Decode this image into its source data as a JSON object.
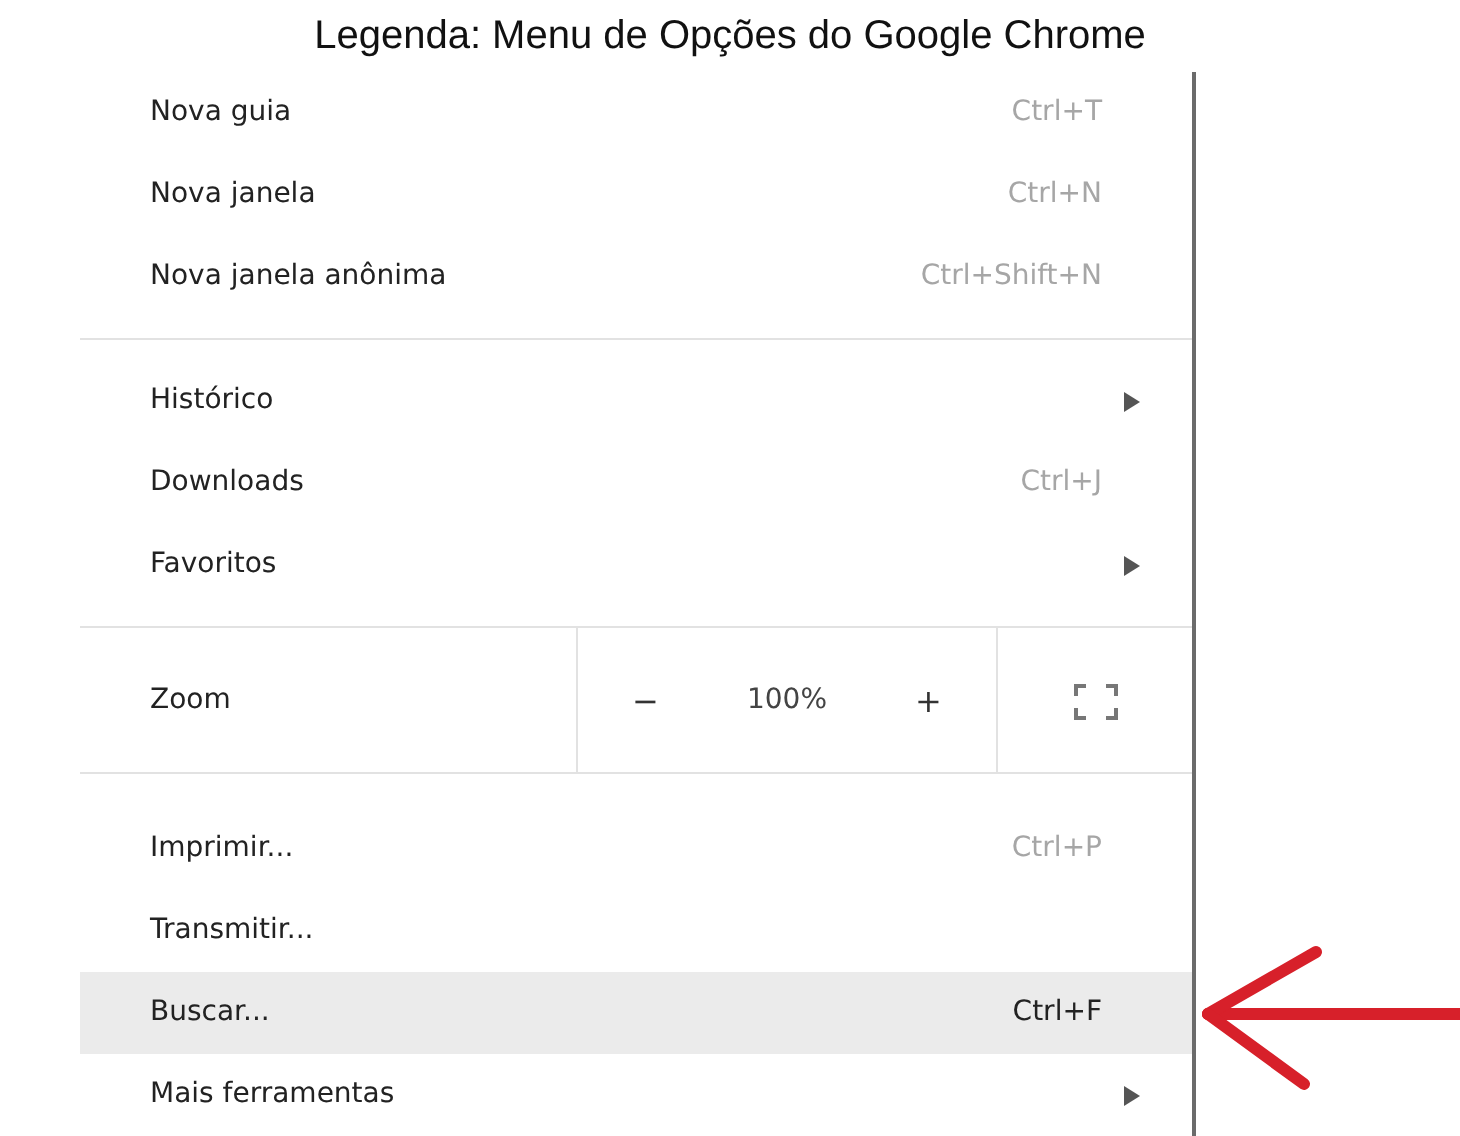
{
  "caption": "Legenda: Menu de Opções do Google Chrome",
  "menu": {
    "sections": [
      {
        "items": [
          {
            "kind": "item",
            "label": "Nova guia",
            "shortcut": "Ctrl+T",
            "highlighted": false
          },
          {
            "kind": "item",
            "label": "Nova janela",
            "shortcut": "Ctrl+N",
            "highlighted": false
          },
          {
            "kind": "item",
            "label": "Nova janela anônima",
            "shortcut": "Ctrl+Shift+N",
            "highlighted": false
          }
        ]
      },
      {
        "items": [
          {
            "kind": "item",
            "label": "Histórico",
            "submenu": true,
            "highlighted": false
          },
          {
            "kind": "item",
            "label": "Downloads",
            "shortcut": "Ctrl+J",
            "highlighted": false
          },
          {
            "kind": "item",
            "label": "Favoritos",
            "submenu": true,
            "highlighted": false
          }
        ]
      },
      {
        "items": [
          {
            "kind": "zoom",
            "label": "Zoom",
            "minus": "−",
            "value": "100%",
            "plus": "+"
          }
        ]
      },
      {
        "items": [
          {
            "kind": "item",
            "label": "Imprimir...",
            "shortcut": "Ctrl+P",
            "highlighted": false
          },
          {
            "kind": "item",
            "label": "Transmitir...",
            "highlighted": false
          },
          {
            "kind": "item",
            "label": "Buscar...",
            "shortcut": "Ctrl+F",
            "highlighted": true
          },
          {
            "kind": "item",
            "label": "Mais ferramentas",
            "submenu": true,
            "highlighted": false
          }
        ]
      }
    ]
  }
}
